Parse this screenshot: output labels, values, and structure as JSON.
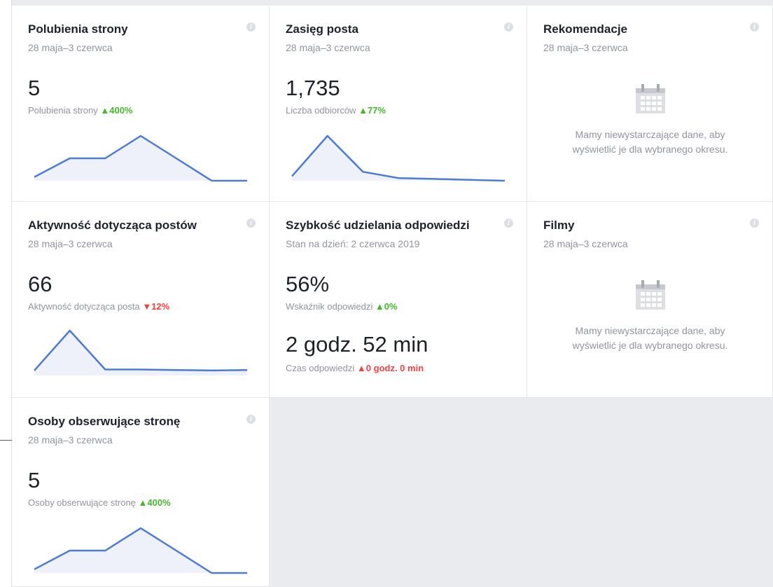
{
  "colors": {
    "line": "#4a7bd8",
    "fill": "#eef0fa",
    "up": "#42b72a",
    "down": "#fa3e3e"
  },
  "cards": {
    "page_likes": {
      "title": "Polubienia strony",
      "subtitle": "28 maja–3 czerwca",
      "value": "5",
      "metric_label": "Polubienia strony",
      "change_symbol": "▲",
      "change": "400%",
      "trend": [
        1,
        6,
        6,
        12,
        6,
        0,
        0
      ]
    },
    "post_reach": {
      "title": "Zasięg posta",
      "subtitle": "28 maja–3 czerwca",
      "value": "1,735",
      "metric_label": "Liczba odbiorców",
      "change_symbol": "▲",
      "change": "77%",
      "trend": [
        1,
        10,
        2,
        0.6,
        0.4,
        0.2,
        0
      ]
    },
    "recommendations": {
      "title": "Rekomendacje",
      "subtitle": "28 maja–3 czerwca",
      "empty_line1": "Mamy niewystarczające dane, aby",
      "empty_line2": "wyświetlić je dla wybranego okresu.",
      "icon": "calendar-icon"
    },
    "post_engagement": {
      "title": "Aktywność dotycząca postów",
      "subtitle": "28 maja–3 czerwca",
      "value": "66",
      "metric_label": "Aktywność dotycząca posta",
      "change_symbol": "▼",
      "change": "12%",
      "trend": [
        1,
        9,
        1.2,
        1.2,
        1.1,
        1,
        1.1
      ]
    },
    "response_speed": {
      "title": "Szybkość udzielania odpowiedzi",
      "subtitle": "Stan na dzień: 2 czerwca 2019",
      "value": "56%",
      "metric_label": "Wskaźnik odpowiedzi",
      "change_symbol": "▲",
      "change": "0%",
      "value2": "2 godz. 52 min",
      "metric_label2": "Czas odpowiedzi",
      "change2_symbol": "▲",
      "change2": "0 godz. 0 min"
    },
    "videos": {
      "title": "Filmy",
      "subtitle": "28 maja–3 czerwca",
      "empty_line1": "Mamy niewystarczające dane, aby",
      "empty_line2": "wyświetlić je dla wybranego okresu.",
      "icon": "calendar-icon"
    },
    "page_followers": {
      "title": "Osoby obserwujące stronę",
      "subtitle": "28 maja–3 czerwca",
      "value": "5",
      "metric_label": "Osoby obserwujące stronę",
      "change_symbol": "▲",
      "change": "400%",
      "trend": [
        1,
        6,
        6,
        12,
        6,
        0,
        0
      ]
    }
  }
}
